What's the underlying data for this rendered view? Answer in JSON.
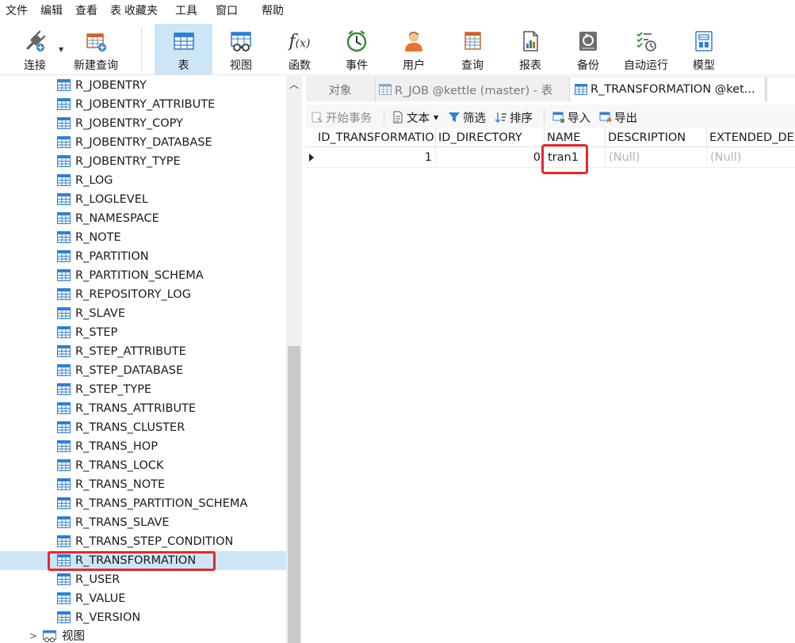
{
  "menu": [
    "文件",
    "编辑",
    "查看",
    "表",
    "收藏夹",
    "工具",
    "窗口",
    "帮助"
  ],
  "toolbar": {
    "connect": "连接",
    "new_query": "新建查询",
    "table": "表",
    "view": "视图",
    "function": "函数",
    "event": "事件",
    "user": "用户",
    "query": "查询",
    "report": "报表",
    "backup": "备份",
    "auto_run": "自动运行",
    "model": "模型"
  },
  "tree": {
    "items": [
      "R_JOBENTRY",
      "R_JOBENTRY_ATTRIBUTE",
      "R_JOBENTRY_COPY",
      "R_JOBENTRY_DATABASE",
      "R_JOBENTRY_TYPE",
      "R_LOG",
      "R_LOGLEVEL",
      "R_NAMESPACE",
      "R_NOTE",
      "R_PARTITION",
      "R_PARTITION_SCHEMA",
      "R_REPOSITORY_LOG",
      "R_SLAVE",
      "R_STEP",
      "R_STEP_ATTRIBUTE",
      "R_STEP_DATABASE",
      "R_STEP_TYPE",
      "R_TRANS_ATTRIBUTE",
      "R_TRANS_CLUSTER",
      "R_TRANS_HOP",
      "R_TRANS_LOCK",
      "R_TRANS_NOTE",
      "R_TRANS_PARTITION_SCHEMA",
      "R_TRANS_SLAVE",
      "R_TRANS_STEP_CONDITION",
      "R_TRANSFORMATION",
      "R_USER",
      "R_VALUE",
      "R_VERSION"
    ],
    "selected_index": 25,
    "views_node": "视图"
  },
  "tabs": {
    "objects": "对象",
    "tab1": "R_JOB @kettle (master) - 表",
    "tab2": "R_TRANSFORMATION @ket..."
  },
  "subtoolbar": {
    "begin_transaction": "开始事务",
    "text": "文本",
    "filter": "筛选",
    "sort": "排序",
    "import": "导入",
    "export": "导出"
  },
  "grid": {
    "columns": [
      "ID_TRANSFORMATION",
      "ID_DIRECTORY",
      "NAME",
      "DESCRIPTION",
      "EXTENDED_DESCRIPTION"
    ],
    "rows": [
      [
        "1",
        "0",
        "tran1",
        "(Null)",
        "(Null)"
      ]
    ]
  },
  "colors": {
    "selection": "#cde6f7",
    "highlight_box": "#e8262b",
    "table_icon": "#2f7fd6"
  }
}
